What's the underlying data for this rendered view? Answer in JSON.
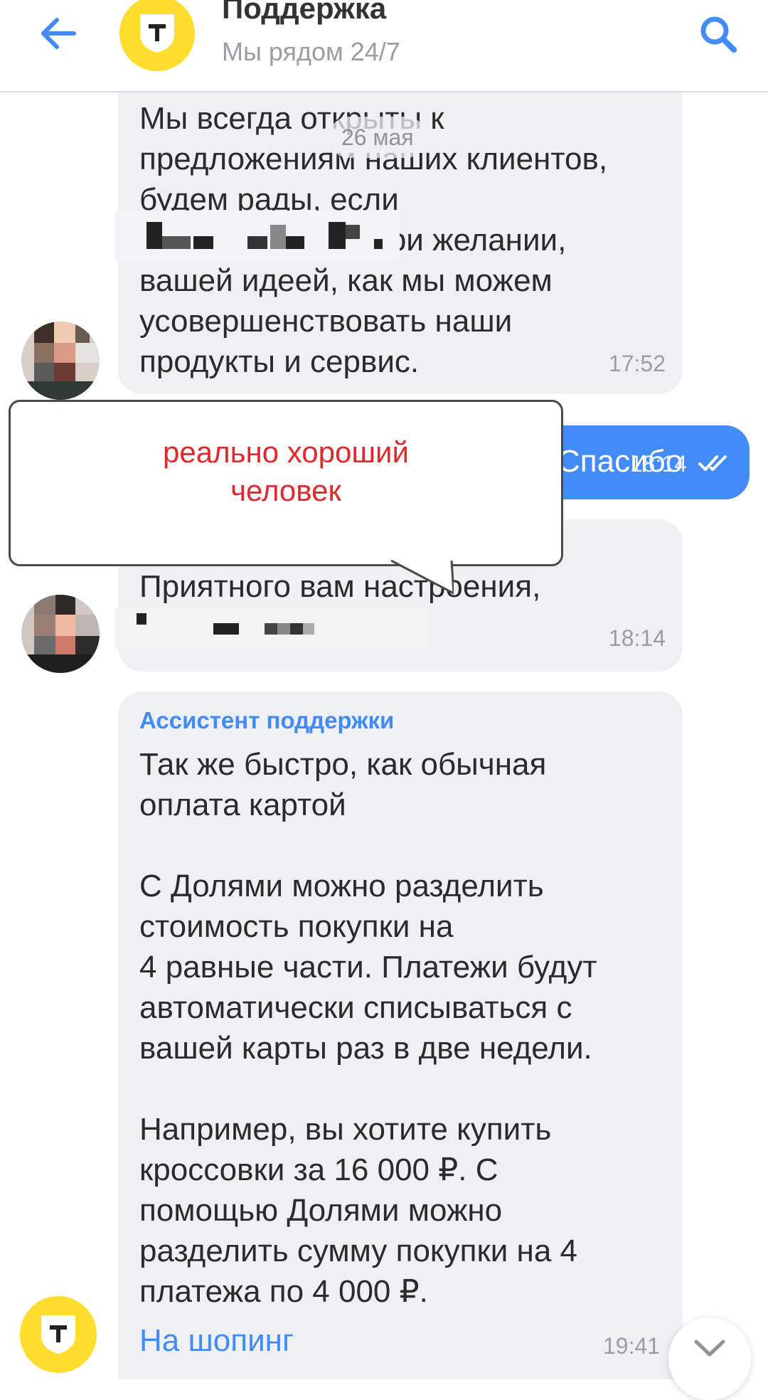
{
  "header": {
    "title": "Поддержка",
    "subtitle": "Мы рядом 24/7"
  },
  "chat": {
    "date_chip": "26 мая",
    "messages": [
      {
        "text": "Мы всегда открыты к\nпредложениям наших клиентов,\nбудем рады, если\nвы поделитесь, при желании,\nвашей идеей, как мы можем\nусовершенствовать наши\nпродукты и сервис.",
        "time": "17:52"
      },
      {
        "text": "Спасибо",
        "time": "18:14"
      },
      {
        "text": "Приятного вам настроения,",
        "time": "18:14"
      },
      {
        "sender": "Ассистент поддержки",
        "text": "Так же быстро, как обычная\nоплата картой\n\nС Долями можно разделить\nстоимость покупки на\n4 равные части. Платежи будут\nавтоматически списываться с\nвашей карты раз в две недели.\n\nНапример, вы хотите купить\nкроссовки за 16 000 ₽. С\nпомощью Долями можно\nразделить сумму покупки на 4\nплатежа по 4 000 ₽.",
        "link": "На шопинг",
        "time": "19:41"
      }
    ]
  },
  "callout": {
    "text": "реально хороший\nчеловек"
  },
  "colors": {
    "accent": "#428bf9",
    "brand_yellow": "#ffdd2d",
    "bubble_incoming": "#eef0f4",
    "callout_text": "#e0292e"
  },
  "icons": [
    "back-arrow-icon",
    "tbank-shield-icon",
    "search-icon",
    "double-check-icon",
    "chevron-down-icon"
  ]
}
